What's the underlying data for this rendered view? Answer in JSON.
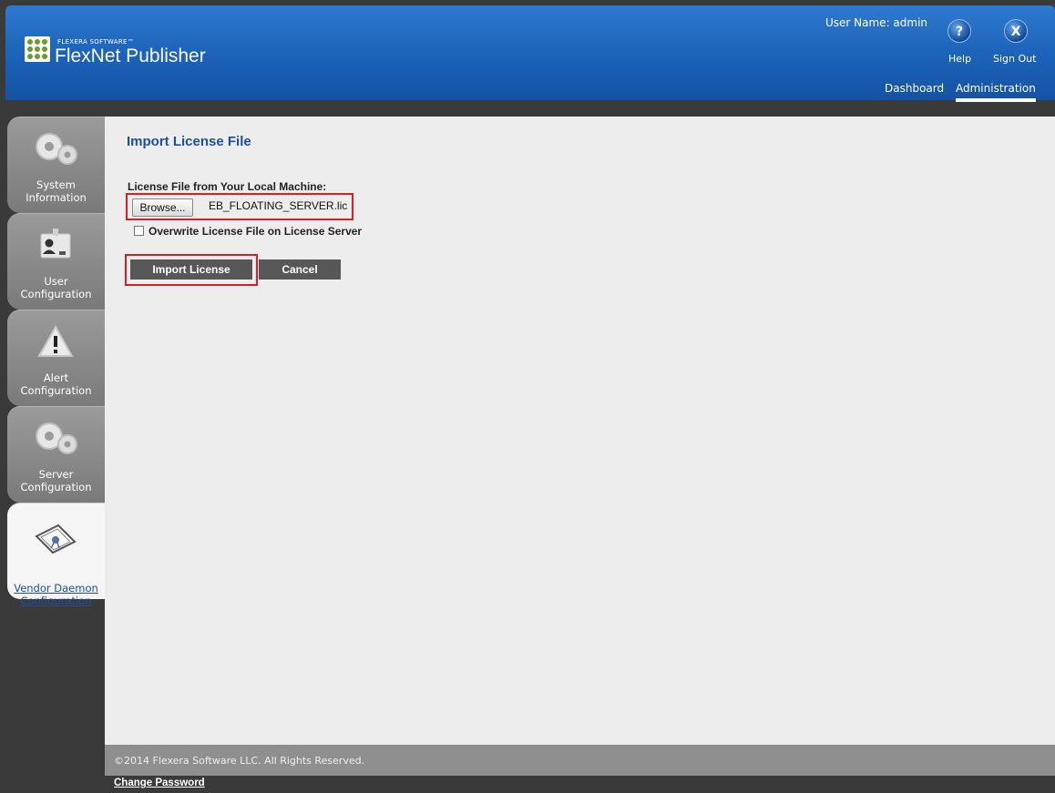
{
  "header": {
    "brand_small": "FLEXERA SOFTWARE™",
    "brand_main": "FlexNet Publisher",
    "user_name": "User Name: admin",
    "help_label": "Help",
    "signout_label": "Sign Out",
    "help_glyph": "?",
    "signout_glyph": "X",
    "nav": {
      "dashboard": "Dashboard",
      "administration": "Administration"
    }
  },
  "sidebar": {
    "items": [
      {
        "label": "System Information",
        "icon": "gears-icon"
      },
      {
        "label": "User Configuration",
        "icon": "id-badge-icon"
      },
      {
        "label": "Alert Configuration",
        "icon": "warning-icon"
      },
      {
        "label": "Server Configuration",
        "icon": "gears-icon"
      },
      {
        "label": "Vendor Daemon Configuration",
        "icon": "certificate-icon",
        "active": true
      }
    ]
  },
  "main": {
    "title": "Import License File",
    "file_label": "License File from Your Local Machine:",
    "browse_label": "Browse...",
    "file_name": "EB_FLOATING_SERVER.lic",
    "overwrite_label": "Overwrite License File on License Server",
    "overwrite_checked": false,
    "import_label": "Import License",
    "cancel_label": "Cancel"
  },
  "footer": {
    "copyright": "©2014 Flexera Software LLC. All Rights Reserved.",
    "change_password": "Change Password"
  },
  "colors": {
    "header_blue": "#1b62b8",
    "title_blue": "#1f4f9a",
    "highlight_red": "#d9201f"
  }
}
